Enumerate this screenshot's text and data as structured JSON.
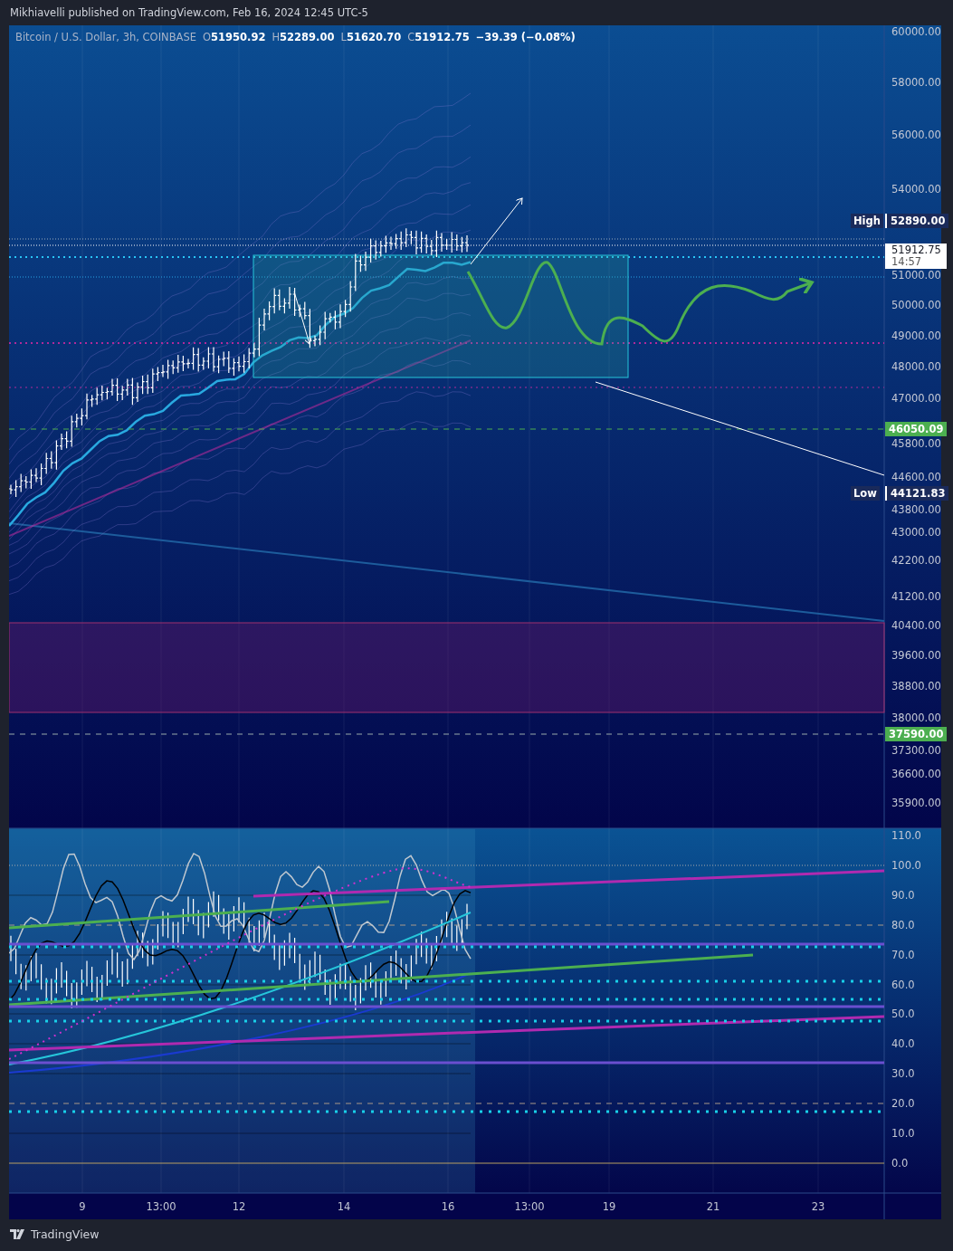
{
  "header": {
    "text": "Mikhiavelli published on TradingView.com, Feb 16, 2024 12:45 UTC-5"
  },
  "legend": {
    "symbol": "Bitcoin / U.S. Dollar, 3h, COINBASE",
    "ohlc": [
      {
        "label": "O",
        "value": "51950.92"
      },
      {
        "label": "H",
        "value": "52289.00"
      },
      {
        "label": "L",
        "value": "51620.70"
      },
      {
        "label": "C",
        "value": "51912.75"
      }
    ],
    "change": "−39.39 (−0.08%)"
  },
  "price_axis": {
    "labels": [
      "60000.00",
      "58000.00",
      "56000.00",
      "54000.00",
      "51000.00",
      "50000.00",
      "49000.00",
      "48000.00",
      "47000.00",
      "45800.00",
      "44600.00",
      "43800.00",
      "43000.00",
      "42200.00",
      "41200.00",
      "40400.00",
      "39600.00",
      "38800.00",
      "38000.00",
      "37300.00",
      "36600.00",
      "35900.00"
    ]
  },
  "price_tags": [
    {
      "kind": "extreme",
      "label": "High",
      "value": "52890.00"
    },
    {
      "kind": "last",
      "value": "51912.75",
      "countdown": "14:57"
    },
    {
      "kind": "line",
      "value": "46050.09"
    },
    {
      "kind": "extreme",
      "label": "Low",
      "value": "44121.83"
    },
    {
      "kind": "line",
      "value": "37590.00"
    }
  ],
  "oscillator_axis": {
    "labels": [
      "110.0",
      "100.0",
      "90.0",
      "80.0",
      "70.0",
      "60.0",
      "50.0",
      "40.0",
      "30.0",
      "20.0",
      "10.0",
      "0.0"
    ]
  },
  "time_axis": {
    "labels": [
      "9",
      "13:00",
      "12",
      "14",
      "16",
      "13:00",
      "19",
      "21",
      "23"
    ]
  },
  "footer": {
    "brand": "TradingView"
  }
}
